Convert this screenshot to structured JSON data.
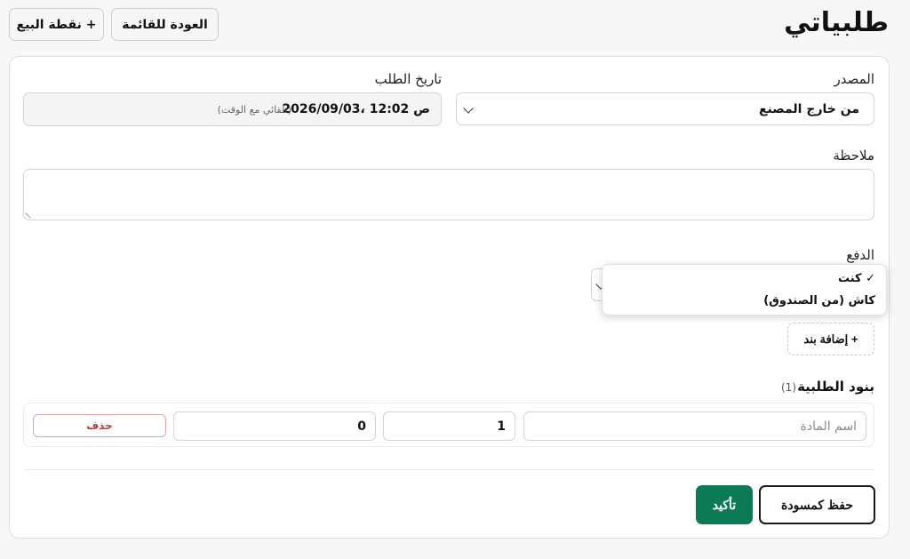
{
  "header": {
    "title": "طلبياتي",
    "back_label": "العودة للقائمة",
    "pos_label": "+ نقطة البيع"
  },
  "form": {
    "source_label": "المصدر",
    "source_value": "من خارج المصنع",
    "date_label": "تاريخ الطلب",
    "date_value": "2026/09/03، 12:02 ص",
    "date_hint": "(تلقائي مع الوقت)",
    "note_label": "ملاحظة",
    "note_value": "",
    "payment_label": "الدفع",
    "payment_options": [
      {
        "label": "✓ كنت",
        "selected": true
      },
      {
        "label": "كاش (من الصندوق)",
        "selected": false
      }
    ],
    "add_item_label": "+ إضافة بند"
  },
  "items": {
    "title": "بنود الطلبية",
    "count": "(1)",
    "rows": [
      {
        "name_placeholder": "اسم المادة",
        "qty": "1",
        "price": "0",
        "delete_label": "حذف"
      }
    ]
  },
  "actions": {
    "draft_label": "حفظ كمسودة",
    "confirm_label": "تأكيد"
  },
  "colors": {
    "accent": "#0b7a55",
    "danger": "#c73737"
  }
}
